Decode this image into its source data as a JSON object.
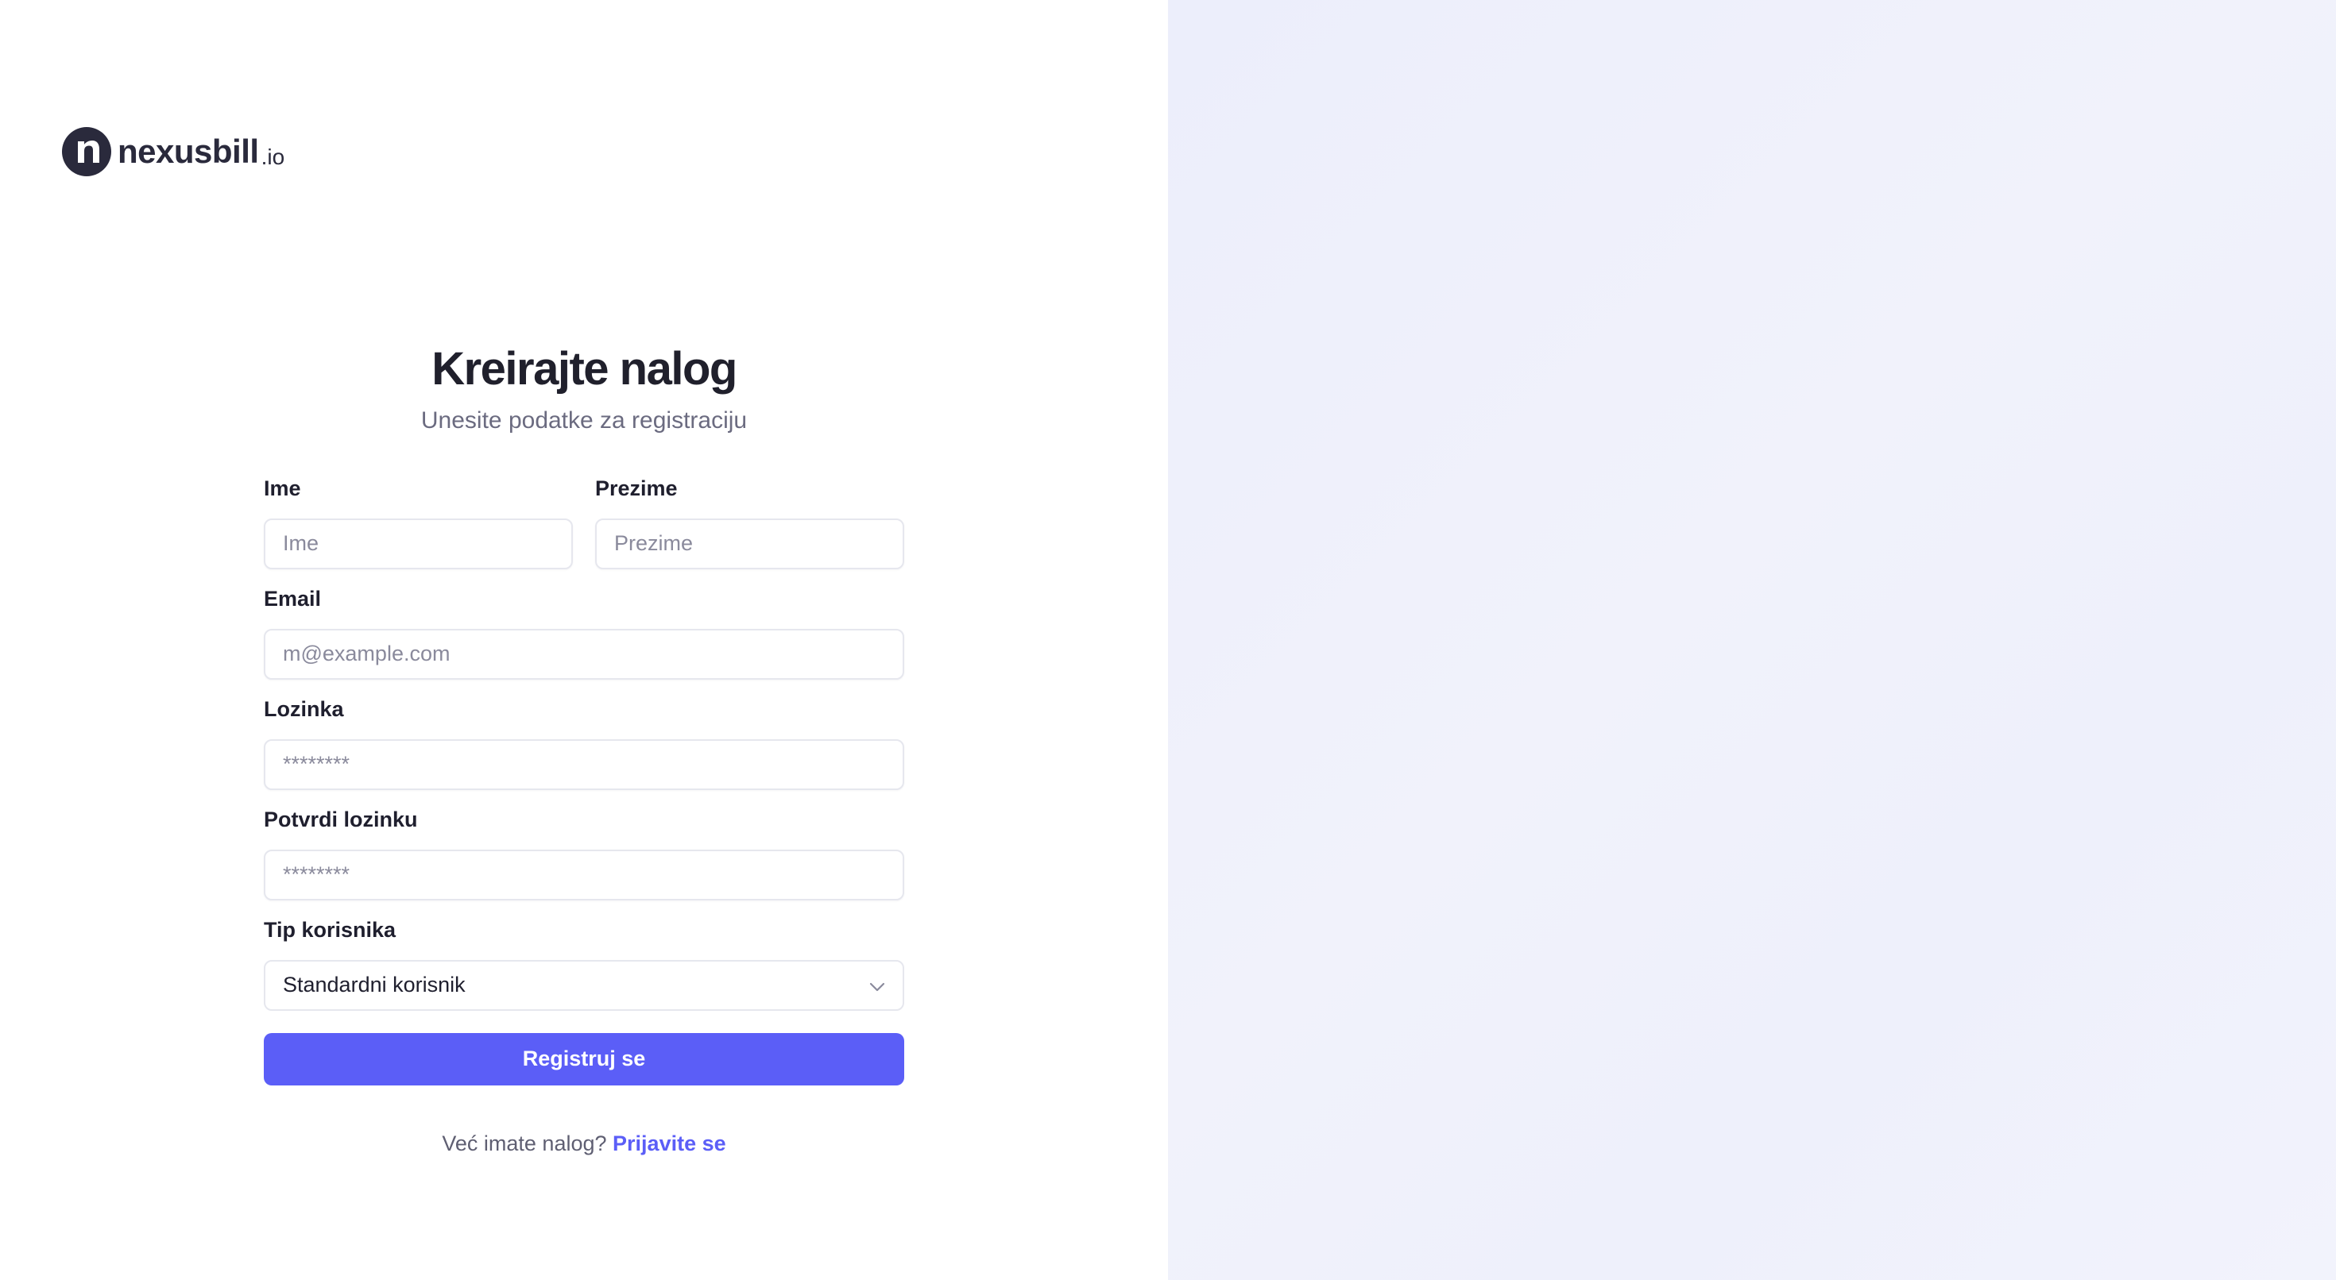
{
  "brand": {
    "name": "nexusbill",
    "tld": ".io"
  },
  "form": {
    "title": "Kreirajte nalog",
    "subtitle": "Unesite podatke za registraciju",
    "first_name": {
      "label": "Ime",
      "placeholder": "Ime"
    },
    "last_name": {
      "label": "Prezime",
      "placeholder": "Prezime"
    },
    "email": {
      "label": "Email",
      "placeholder": "m@example.com"
    },
    "password": {
      "label": "Lozinka",
      "placeholder": "********"
    },
    "confirm_password": {
      "label": "Potvrdi lozinku",
      "placeholder": "********"
    },
    "user_type": {
      "label": "Tip korisnika",
      "value": "Standardni korisnik",
      "icon": "chevron-down-icon"
    },
    "submit_label": "Registruj se",
    "signin_prompt": "Već imate nalog?",
    "signin_link": "Prijavite se"
  },
  "colors": {
    "accent": "#5b5ef7",
    "text": "#1f1f2e",
    "muted": "#6b6b80",
    "right_panel": "#eef0fb"
  }
}
